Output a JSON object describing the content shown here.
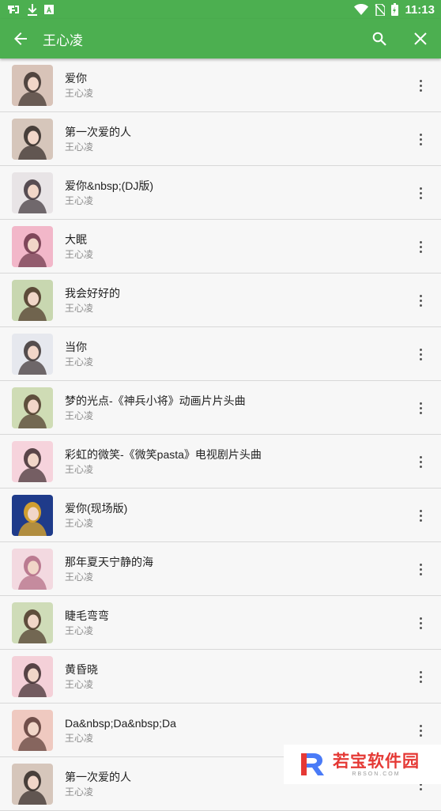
{
  "status_bar": {
    "time": "11:13",
    "left_icons": [
      "app-notification-icon",
      "download-icon",
      "a-icon"
    ],
    "right_icons": [
      "wifi-icon",
      "no-sim-icon",
      "battery-icon"
    ]
  },
  "toolbar": {
    "title": "王心凌",
    "back_icon": "arrow-back-icon",
    "search_icon": "search-icon",
    "close_icon": "close-icon",
    "color": "#4caf50"
  },
  "songs": [
    {
      "title": "爱你",
      "artist": "王心凌",
      "cover": [
        "#d8c3b8",
        "#3a2f2a"
      ]
    },
    {
      "title": "第一次爱的人",
      "artist": "王心凌",
      "cover": [
        "#d6c6bb",
        "#2f2723"
      ]
    },
    {
      "title": "爱你&nbsp;(DJ版)",
      "artist": "王心凌",
      "cover": [
        "#e8e4e6",
        "#3d3338"
      ]
    },
    {
      "title": "大眠",
      "artist": "王心凌",
      "cover": [
        "#f2b7c9",
        "#6b3447"
      ]
    },
    {
      "title": "我会好好的",
      "artist": "王心凌",
      "cover": [
        "#c8d7b0",
        "#4a3325"
      ]
    },
    {
      "title": "当你",
      "artist": "王心凌",
      "cover": [
        "#e6e8ee",
        "#3a3130"
      ]
    },
    {
      "title": "梦的光点-《神兵小将》动画片片头曲",
      "artist": "王心凌",
      "cover": [
        "#cfdcb5",
        "#4b3628"
      ]
    },
    {
      "title": "彩虹的微笑-《微笑pasta》电视剧片头曲",
      "artist": "王心凌",
      "cover": [
        "#f6d3dc",
        "#3e2c2f"
      ]
    },
    {
      "title": "爱你(现场版)",
      "artist": "王心凌",
      "cover": [
        "#1f3b8a",
        "#f0b020"
      ]
    },
    {
      "title": "那年夏天宁静的海",
      "artist": "王心凌",
      "cover": [
        "#f3d9e0",
        "#b06a82"
      ]
    },
    {
      "title": "睫毛弯弯",
      "artist": "王心凌",
      "cover": [
        "#cfdcb8",
        "#4a3426"
      ]
    },
    {
      "title": "黄昏晓",
      "artist": "王心凌",
      "cover": [
        "#f4d0d8",
        "#3b2a2c"
      ]
    },
    {
      "title": "Da&nbsp;Da&nbsp;Da",
      "artist": "王心凌",
      "cover": [
        "#efc9c0",
        "#5a3a35"
      ]
    },
    {
      "title": "第一次爱的人",
      "artist": "王心凌",
      "cover": [
        "#d6c6bb",
        "#2f2723"
      ]
    }
  ],
  "watermark": {
    "text": "若宝软件园",
    "sub": "RBSON.COM"
  }
}
